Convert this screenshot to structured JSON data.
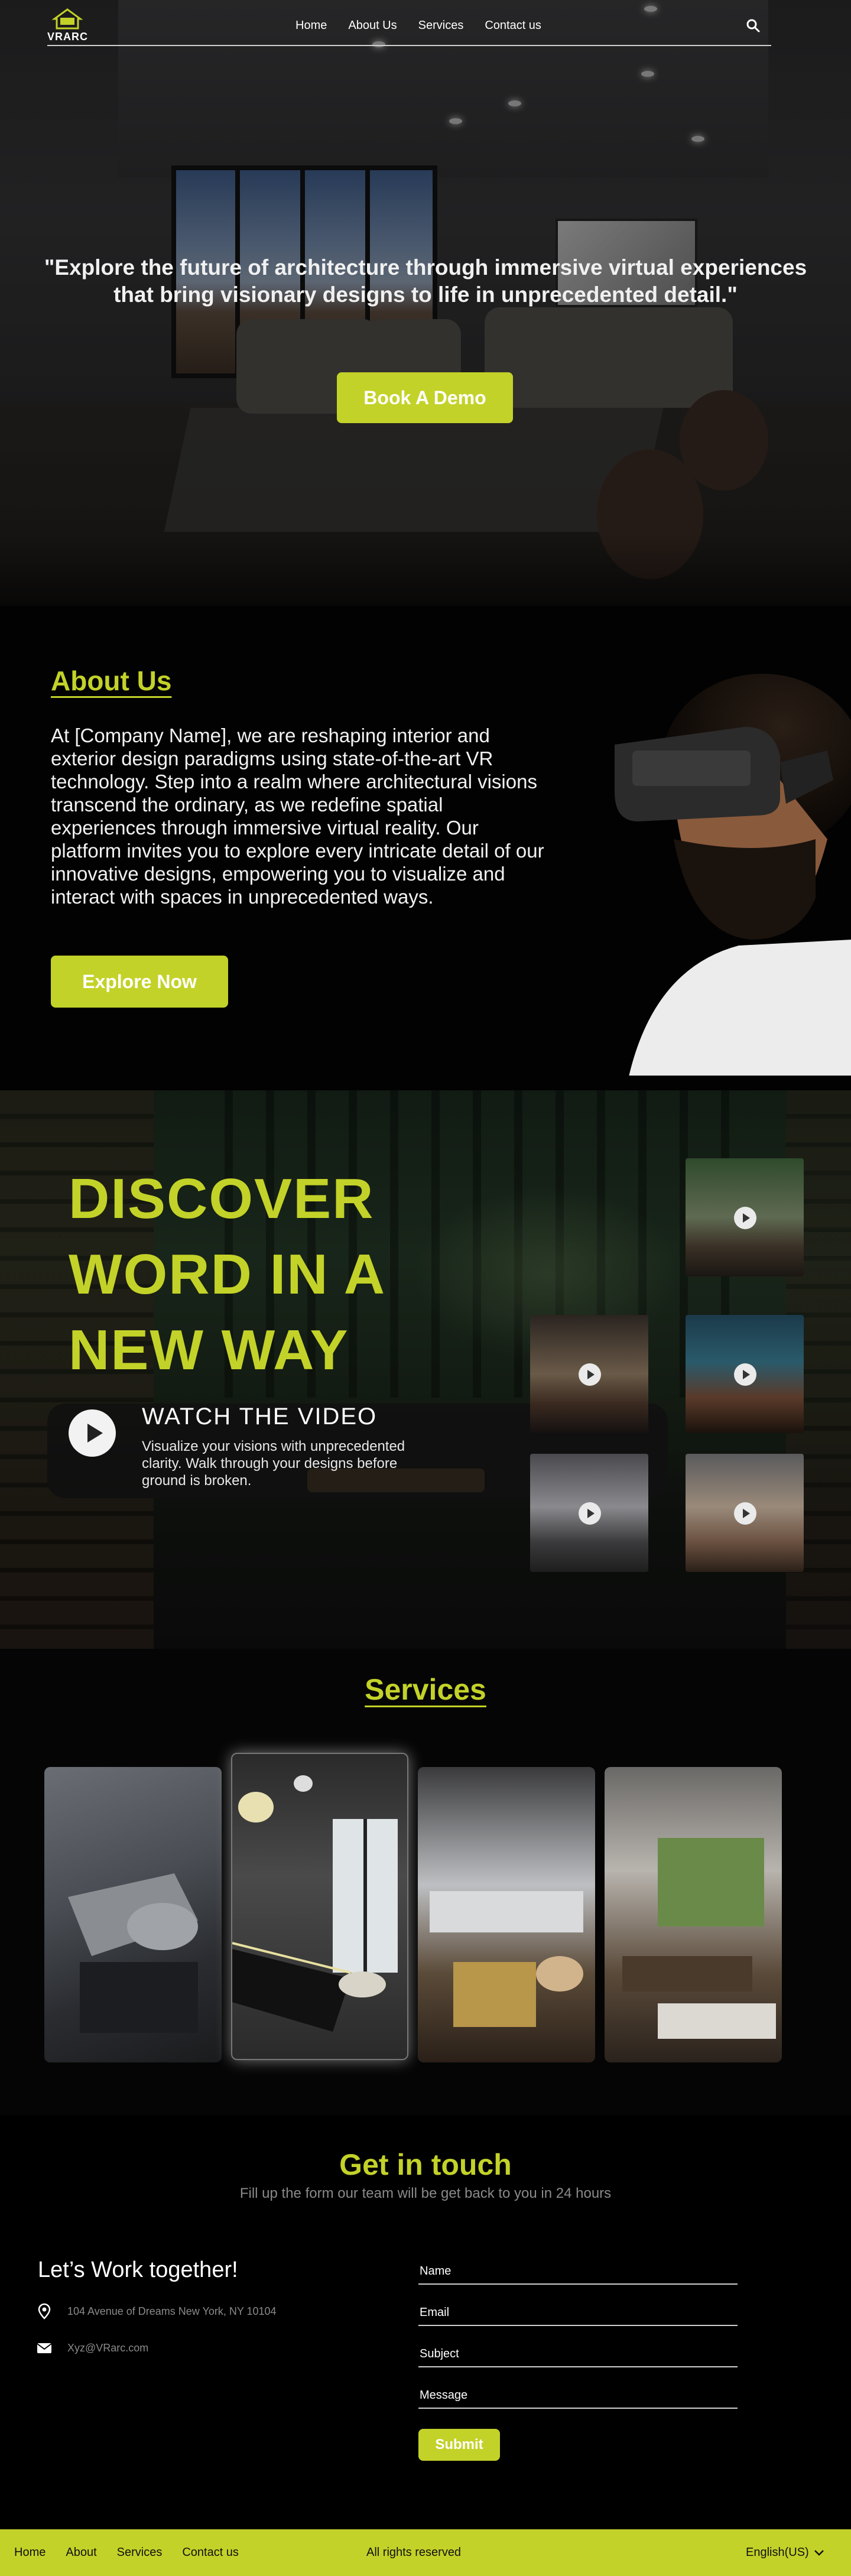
{
  "brand": {
    "logo_text": "VRARC"
  },
  "nav": {
    "links": [
      "Home",
      "About Us",
      "Services",
      "Contact us"
    ],
    "search_icon": "search-icon"
  },
  "hero": {
    "quote": "\"Explore the future of architecture through immersive virtual experiences that bring visionary designs to life in unprecedented detail.\"",
    "cta": "Book A Demo"
  },
  "about": {
    "title": "About Us",
    "body": "At [Company Name], we are reshaping interior and exterior design paradigms using state-of-the-art VR technology. Step into a realm where architectural visions transcend the ordinary, as we redefine spatial experiences through immersive virtual reality. Our platform invites you to explore every intricate detail of our innovative designs, empowering you to visualize and interact with spaces in unprecedented ways.",
    "cta": "Explore Now"
  },
  "discover": {
    "headline": "DISCOVER WORD IN A NEW WAY",
    "watch_title": "WATCH THE VIDEO",
    "watch_text": "Visualize your visions with unprecedented clarity. Walk through your designs before ground is broken."
  },
  "services": {
    "title": "Services"
  },
  "contact": {
    "title": "Get in touch",
    "subtitle": "Fill up the form our team will be get back to you in 24 hours",
    "heading": "Let’s Work together!",
    "address": "104 Avenue of Dreams New York, NY 10104",
    "email": "Xyz@VRarc.com",
    "fields": {
      "name": "Name",
      "email": "Email",
      "subject": "Subject",
      "message": "Message"
    },
    "submit": "Submit"
  },
  "footer": {
    "links": [
      "Home",
      "About",
      "Services",
      "Contact us"
    ],
    "rights": "All rights reserved",
    "language": "English(US)"
  },
  "colors": {
    "accent": "#c3d228",
    "background": "#000000",
    "muted_text": "#8a8a8a"
  }
}
